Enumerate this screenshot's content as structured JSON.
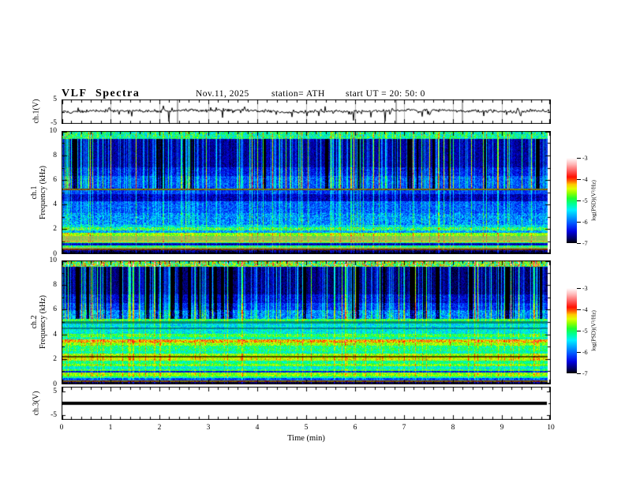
{
  "header": {
    "title": "VLF Spectra",
    "date": "Nov.11, 2025",
    "station": "station= ATH",
    "start_ut": "start UT =  20: 50: 0"
  },
  "x_axis": {
    "label": "Time (min)",
    "ticks": [
      "0",
      "1",
      "2",
      "3",
      "4",
      "5",
      "6",
      "7",
      "8",
      "9",
      "10"
    ],
    "range_min": [
      0,
      10
    ],
    "minor_per_major": 5
  },
  "panels": {
    "wave1": {
      "ylabel": "ch.1(V)",
      "yticks": [
        "5",
        "-5"
      ],
      "ylim_V": [
        -5,
        5
      ]
    },
    "spec1": {
      "ylabel_line1": "ch.1",
      "ylabel_line2": "Frequency (kHz)",
      "yticks": [
        "10",
        "8",
        "6",
        "4",
        "2",
        "0"
      ],
      "ylim_kHz": [
        0,
        10
      ]
    },
    "spec2": {
      "ylabel_line1": "ch.2",
      "ylabel_line2": "Frequency (kHz)",
      "yticks": [
        "10",
        "8",
        "6",
        "4",
        "2",
        "0"
      ],
      "ylim_kHz": [
        0,
        10
      ]
    },
    "wave3": {
      "ylabel": "ch.3(V)",
      "yticks": [
        "5",
        "-5"
      ],
      "ylim_V": [
        -7,
        7
      ]
    }
  },
  "colorbar": {
    "label": "log(PSD)(V²/Hz)",
    "ticks": [
      "-3",
      "-4",
      "-5",
      "-6",
      "-7"
    ],
    "range": [
      -7,
      -3
    ],
    "stops": [
      {
        "v": -7.0,
        "c": "#000000"
      },
      {
        "v": -6.8,
        "c": "#000060"
      },
      {
        "v": -6.45,
        "c": "#0000e0"
      },
      {
        "v": -6.1,
        "c": "#0050ff"
      },
      {
        "v": -5.75,
        "c": "#00a8ff"
      },
      {
        "v": -5.45,
        "c": "#00f0ff"
      },
      {
        "v": -5.15,
        "c": "#00ff90"
      },
      {
        "v": -4.9,
        "c": "#20ff30"
      },
      {
        "v": -4.65,
        "c": "#90ff00"
      },
      {
        "v": -4.45,
        "c": "#e0ff00"
      },
      {
        "v": -4.25,
        "c": "#ffc800"
      },
      {
        "v": -4.05,
        "c": "#ff5000"
      },
      {
        "v": -3.9,
        "c": "#ff1000"
      },
      {
        "v": -3.6,
        "c": "#ff6060"
      },
      {
        "v": -3.3,
        "c": "#ffb8b8"
      },
      {
        "v": -3.0,
        "c": "#ffffff"
      }
    ]
  },
  "chart_data": [
    {
      "type": "line",
      "name": "ch1_waveform",
      "x_range_min": [
        0,
        10
      ],
      "y_range_V": [
        -5,
        5
      ],
      "baseline_V": 0.3,
      "noise_amp_V": 0.55,
      "seed": 13,
      "spikes": [
        {
          "t": 0.32,
          "v": 1.7
        },
        {
          "t": 1.42,
          "v": -2.0
        },
        {
          "t": 2.18,
          "v": -4.3
        },
        {
          "t": 3.28,
          "v": -2.6
        },
        {
          "t": 4.7,
          "v": -2.3
        },
        {
          "t": 5.0,
          "v": -1.9
        },
        {
          "t": 5.95,
          "v": -3.8
        },
        {
          "t": 6.3,
          "v": -2.4
        },
        {
          "t": 6.6,
          "v": -4.2
        },
        {
          "t": 7.35,
          "v": -2.1
        },
        {
          "t": 8.62,
          "v": -1.9
        },
        {
          "t": 9.3,
          "v": 1.6
        }
      ],
      "gray_spikes_t": [
        2.35,
        6.82,
        8.17
      ]
    },
    {
      "type": "heatmap",
      "name": "ch1_spectrogram",
      "x_range_min": [
        0,
        9.92
      ],
      "y_range_kHz": [
        0,
        10
      ],
      "z_range_logPSD": [
        -7,
        -3
      ],
      "seed": 101,
      "strong_streak_prob": 0.11,
      "bands": [
        {
          "f0": 9.45,
          "f1": 10.0,
          "level": -5.3,
          "noise": 0.55
        },
        {
          "f0": 7.1,
          "f1": 9.45,
          "level": -6.75,
          "noise": 0.2
        },
        {
          "f0": 6.4,
          "f1": 7.1,
          "level": -6.5,
          "noise": 0.3
        },
        {
          "f0": 5.5,
          "f1": 6.4,
          "level": -6.2,
          "noise": 0.35
        },
        {
          "f0": 5.32,
          "f1": 5.5,
          "level": -6.25,
          "noise": 0.3
        },
        {
          "f0": 5.2,
          "f1": 5.32,
          "level": -4.5,
          "noise": 0.25,
          "dim": 0.55
        },
        {
          "f0": 4.9,
          "f1": 5.2,
          "level": -6.3,
          "noise": 0.3
        },
        {
          "f0": 4.3,
          "f1": 4.9,
          "level": -6.65,
          "noise": 0.25
        },
        {
          "f0": 3.3,
          "f1": 4.3,
          "level": -6.15,
          "noise": 0.35
        },
        {
          "f0": 2.3,
          "f1": 3.3,
          "level": -5.95,
          "noise": 0.45
        },
        {
          "f0": 2.15,
          "f1": 2.3,
          "level": -5.6,
          "noise": 0.5
        },
        {
          "f0": 1.85,
          "f1": 2.15,
          "level": -5.1,
          "noise": 0.6
        },
        {
          "f0": 1.68,
          "f1": 1.85,
          "level": -5.85,
          "noise": 0.4
        },
        {
          "f0": 1.42,
          "f1": 1.68,
          "level": -4.75,
          "noise": 0.35
        },
        {
          "f0": 1.02,
          "f1": 1.42,
          "level": -4.8,
          "noise": 0.25,
          "desat": 0.55
        },
        {
          "f0": 0.9,
          "f1": 1.02,
          "level": -4.5,
          "noise": 0.2,
          "desat": 0.35
        },
        {
          "f0": 0.8,
          "f1": 0.9,
          "level": -5.1,
          "noise": 0.3
        },
        {
          "f0": 0.6,
          "f1": 0.8,
          "level": -6.6,
          "noise": 0.2
        },
        {
          "f0": 0.5,
          "f1": 0.6,
          "level": -5.2,
          "noise": 0.35
        },
        {
          "f0": 0.34,
          "f1": 0.5,
          "level": -4.9,
          "noise": 0.25,
          "desat": 0.5
        },
        {
          "f0": 0.26,
          "f1": 0.34,
          "level": -4.15,
          "noise": 0.15,
          "dim": 0.5
        },
        {
          "f0": 0.08,
          "f1": 0.26,
          "level": -6.8,
          "noise": 0.3
        },
        {
          "f0": 0.0,
          "f1": 0.08,
          "level": -7.0,
          "noise": 0.05
        }
      ],
      "streak_weights": [
        {
          "f0": 9.45,
          "f1": 10.0,
          "w": 0.45
        },
        {
          "f0": 5.32,
          "f1": 9.45,
          "w": 1.0
        },
        {
          "f0": 2.3,
          "f1": 5.32,
          "w": 0.5
        },
        {
          "f0": 0.0,
          "f1": 2.3,
          "w": 0.3
        }
      ]
    },
    {
      "type": "heatmap",
      "name": "ch2_spectrogram",
      "x_range_min": [
        0,
        9.92
      ],
      "y_range_kHz": [
        0,
        10
      ],
      "z_range_logPSD": [
        -7,
        -3
      ],
      "seed": 202,
      "strong_streak_prob": 0.11,
      "bands": [
        {
          "f0": 9.6,
          "f1": 10.0,
          "level": -5.0,
          "noise": 0.8
        },
        {
          "f0": 7.3,
          "f1": 9.6,
          "level": -6.85,
          "noise": 0.18
        },
        {
          "f0": 6.6,
          "f1": 7.3,
          "level": -6.6,
          "noise": 0.28
        },
        {
          "f0": 6.0,
          "f1": 6.6,
          "level": -6.35,
          "noise": 0.3
        },
        {
          "f0": 5.3,
          "f1": 6.0,
          "level": -6.0,
          "noise": 0.45
        },
        {
          "f0": 5.1,
          "f1": 5.3,
          "level": -5.0,
          "noise": 0.4
        },
        {
          "f0": 4.9,
          "f1": 5.1,
          "level": -5.4,
          "noise": 0.35,
          "dim": 0.6
        },
        {
          "f0": 4.6,
          "f1": 4.9,
          "level": -5.55,
          "noise": 0.4
        },
        {
          "f0": 4.42,
          "f1": 4.6,
          "level": -5.6,
          "noise": 0.3,
          "dim": 0.6
        },
        {
          "f0": 4.05,
          "f1": 4.42,
          "level": -5.5,
          "noise": 0.4
        },
        {
          "f0": 3.78,
          "f1": 4.05,
          "level": -5.0,
          "noise": 0.4
        },
        {
          "f0": 3.58,
          "f1": 3.78,
          "level": -5.35,
          "noise": 0.35
        },
        {
          "f0": 3.35,
          "f1": 3.58,
          "level": -4.35,
          "noise": 0.45
        },
        {
          "f0": 3.08,
          "f1": 3.35,
          "level": -4.75,
          "noise": 0.35
        },
        {
          "f0": 2.65,
          "f1": 3.08,
          "level": -5.15,
          "noise": 0.4
        },
        {
          "f0": 2.45,
          "f1": 2.65,
          "level": -5.35,
          "noise": 0.35
        },
        {
          "f0": 2.22,
          "f1": 2.45,
          "level": -4.7,
          "noise": 0.35
        },
        {
          "f0": 2.08,
          "f1": 2.22,
          "level": -4.6,
          "noise": 0.3,
          "dim": 0.35
        },
        {
          "f0": 1.88,
          "f1": 2.08,
          "level": -4.55,
          "noise": 0.3
        },
        {
          "f0": 1.62,
          "f1": 1.88,
          "level": -5.2,
          "noise": 0.35
        },
        {
          "f0": 1.4,
          "f1": 1.62,
          "level": -4.8,
          "noise": 0.35
        },
        {
          "f0": 1.15,
          "f1": 1.4,
          "level": -5.45,
          "noise": 0.35
        },
        {
          "f0": 0.98,
          "f1": 1.15,
          "level": -5.0,
          "noise": 0.35
        },
        {
          "f0": 0.85,
          "f1": 0.98,
          "level": -6.4,
          "noise": 0.25
        },
        {
          "f0": 0.55,
          "f1": 0.85,
          "level": -4.75,
          "noise": 0.3
        },
        {
          "f0": 0.4,
          "f1": 0.55,
          "level": -5.3,
          "noise": 0.35
        },
        {
          "f0": 0.24,
          "f1": 0.4,
          "level": -6.2,
          "noise": 0.3
        },
        {
          "f0": 0.12,
          "f1": 0.24,
          "level": -4.3,
          "noise": 0.2,
          "dim": 0.5
        },
        {
          "f0": 0.0,
          "f1": 0.12,
          "level": -6.9,
          "noise": 0.1
        }
      ],
      "streak_weights": [
        {
          "f0": 9.6,
          "f1": 10.0,
          "w": 0.8
        },
        {
          "f0": 5.3,
          "f1": 9.6,
          "w": 1.0
        },
        {
          "f0": 0.0,
          "f1": 5.3,
          "w": 0.3
        }
      ]
    },
    {
      "type": "line",
      "name": "ch3_waveform",
      "x_range_min": [
        0,
        9.87
      ],
      "y_range_V": [
        -7,
        7
      ],
      "value_V": 0,
      "line_thickness_px": 4
    }
  ]
}
